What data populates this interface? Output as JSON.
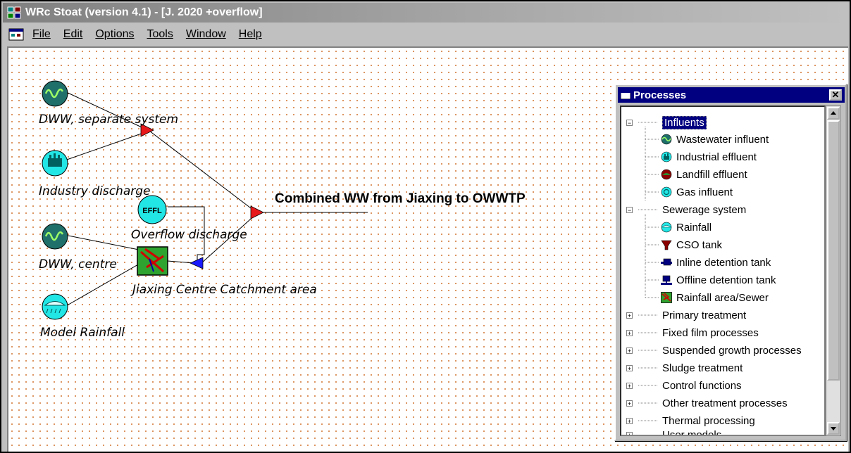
{
  "window": {
    "title": "WRc Stoat (version 4.1) - [J. 2020 +overflow]"
  },
  "menu": {
    "file": "File",
    "edit": "Edit",
    "options": "Options",
    "tools": "Tools",
    "window": "Window",
    "help": "Help"
  },
  "diagram": {
    "labels": {
      "dww_separate": "DWW, separate system",
      "industry": "Industry discharge",
      "overflow": "Overflow discharge",
      "dww_centre": "DWW, centre",
      "catchment": "Jiaxing Centre Catchment area",
      "rainfall": "Model Rainfall",
      "combined": "Combined WW from Jiaxing to OWWTP"
    },
    "effl_text": "EFFL"
  },
  "processes": {
    "title": "Processes",
    "close": "✕",
    "tree": [
      {
        "label": "Influents",
        "expanded": true,
        "selected": true,
        "children": [
          {
            "label": "Wastewater influent",
            "icon": "wastewater-influent-icon"
          },
          {
            "label": "Industrial effluent",
            "icon": "industrial-effluent-icon"
          },
          {
            "label": "Landfill effluent",
            "icon": "landfill-effluent-icon"
          },
          {
            "label": "Gas influent",
            "icon": "gas-influent-icon"
          }
        ]
      },
      {
        "label": "Sewerage system",
        "expanded": true,
        "children": [
          {
            "label": "Rainfall",
            "icon": "rainfall-icon"
          },
          {
            "label": "CSO tank",
            "icon": "cso-tank-icon"
          },
          {
            "label": "Inline detention tank",
            "icon": "inline-detention-tank-icon"
          },
          {
            "label": "Offline detention tank",
            "icon": "offline-detention-tank-icon"
          },
          {
            "label": "Rainfall area/Sewer",
            "icon": "rainfall-area-sewer-icon"
          }
        ]
      },
      {
        "label": "Primary treatment"
      },
      {
        "label": "Fixed film processes"
      },
      {
        "label": "Suspended growth processes"
      },
      {
        "label": "Sludge treatment"
      },
      {
        "label": "Control functions"
      },
      {
        "label": "Other treatment processes"
      },
      {
        "label": "Thermal processing"
      },
      {
        "label": "User models"
      }
    ]
  },
  "colors": {
    "titlebar": "#808080",
    "proc_title": "#000080",
    "grid_dot": "#d37a39",
    "junction_red": "#e8191b",
    "junction_blue": "#1a1aff",
    "teal": "#1f6f6a",
    "cyan": "#22e6e6"
  }
}
